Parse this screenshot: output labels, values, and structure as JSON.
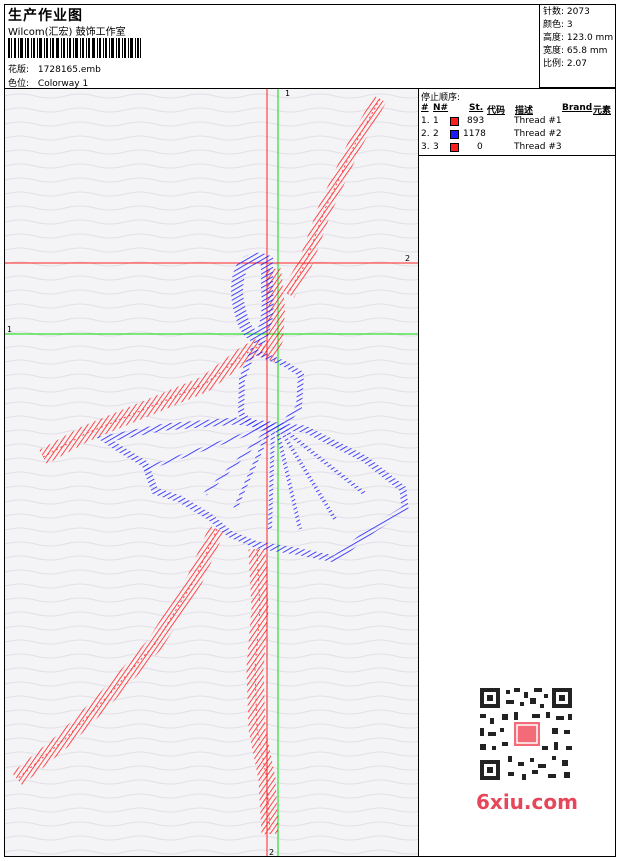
{
  "header": {
    "title": "生产作业图",
    "company": "Wilcom(汇宏) 鼓饰工作室",
    "design_label": "花版:",
    "design_value": "1728165.emb",
    "colorway_label": "色位:",
    "colorway_value": "Colorway 1"
  },
  "stats": [
    {
      "label": "针数:",
      "value": "2073"
    },
    {
      "label": "颜色:",
      "value": "3"
    },
    {
      "label": "高度:",
      "value": "123.0 mm"
    },
    {
      "label": "宽度:",
      "value": "65.8 mm"
    },
    {
      "label": "比例:",
      "value": "2.07"
    }
  ],
  "table": {
    "title": "停止顺序:",
    "headers": {
      "hash": "#",
      "n": "N#",
      "st": "St.",
      "code": "代码",
      "desc": "描述",
      "brand": "Brand",
      "element": "元素"
    },
    "rows": [
      {
        "index": "1.",
        "n": "1",
        "color": "#ff1f1f",
        "st": "893",
        "desc": "Thread #1"
      },
      {
        "index": "2.",
        "n": "2",
        "color": "#1a1aff",
        "st": "1178",
        "desc": "Thread #2"
      },
      {
        "index": "3.",
        "n": "3",
        "color": "#ff1f1f",
        "st": "0",
        "desc": "Thread #3"
      }
    ]
  },
  "markers": {
    "green_v": "1",
    "green_h": "1",
    "red_h": "2",
    "red_v": "2"
  },
  "watermark": "6xiu.com",
  "colors": {
    "thread1": "#ff1f1f",
    "thread2": "#1a1aff",
    "guide_green": "#00dd00",
    "guide_red": "#ff2020"
  }
}
